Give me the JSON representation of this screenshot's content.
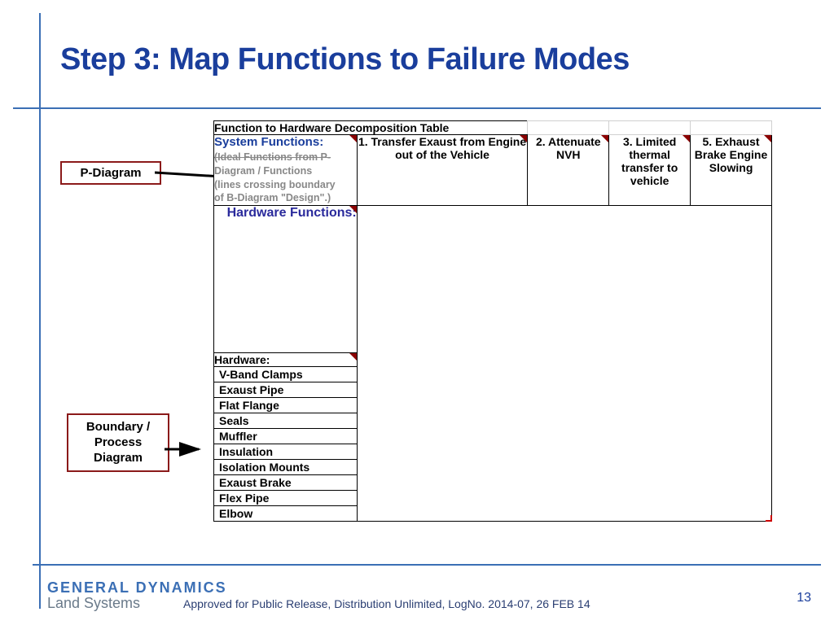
{
  "title": "Step 3: Map Functions to Failure Modes",
  "page_number": "13",
  "logo": {
    "line1": "GENERAL DYNAMICS",
    "line2": "Land Systems"
  },
  "release": "Approved for Public Release, Distribution Unlimited, LogNo. 2014-07, 26 FEB 14",
  "callouts": {
    "pdiagram": "P-Diagram",
    "boundary": "Boundary / Process Diagram"
  },
  "table": {
    "header_title": "Function to Hardware Decomposition Table",
    "sys_functions_title": "System Functions:",
    "sys_functions_sub1": "(Ideal Functions from P-",
    "sys_functions_sub2": "Diagram / Functions",
    "sys_functions_sub3": "(lines crossing boundary",
    "sys_functions_sub4": "of B-Diagram \"Design\".)",
    "col1": "1. Transfer Exaust from Engine out of the Vehicle",
    "col2": "2. Attenuate NVH",
    "col3": "3. Limited thermal transfer to vehicle",
    "col5": "5. Exhaust Brake Engine Slowing",
    "hw_functions_label": "Hardware Functions:",
    "hw_header": "Hardware:",
    "hw": [
      "V-Band Clamps",
      "Exaust Pipe",
      "Flat Flange",
      "Seals",
      "Muffler",
      "Insulation",
      "Isolation Mounts",
      "Exaust Brake",
      "Flex Pipe",
      "Elbow"
    ]
  }
}
